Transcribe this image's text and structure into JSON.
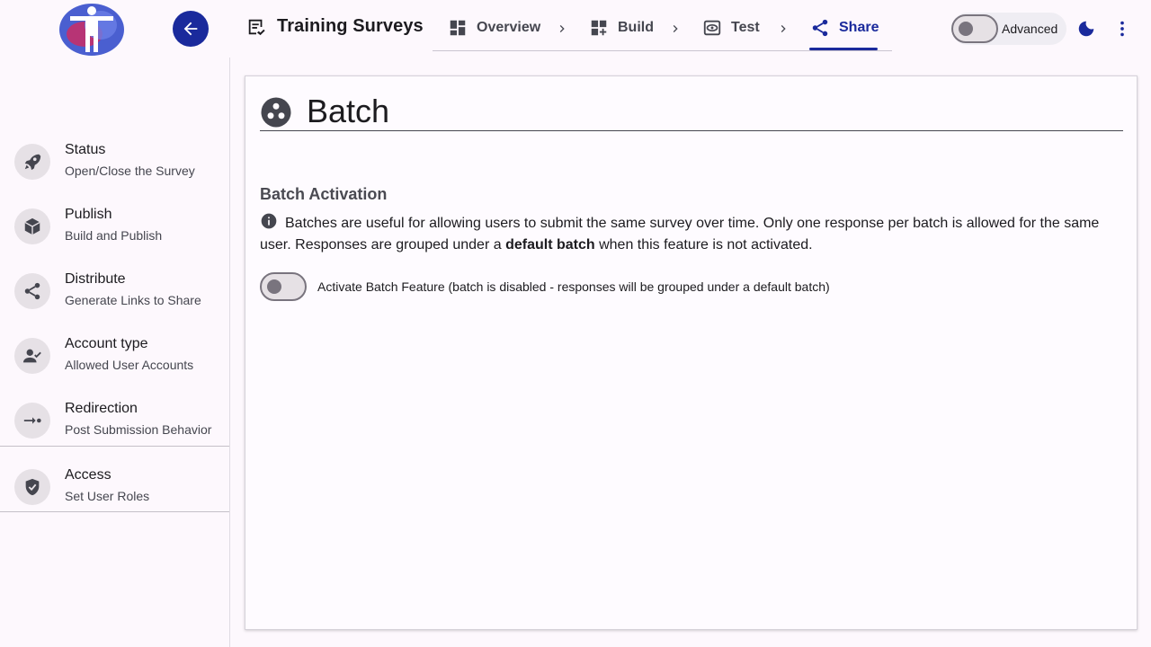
{
  "header": {
    "survey_title": "Training Surveys",
    "advanced_label": "Advanced",
    "advanced_enabled": false
  },
  "nav": {
    "tabs": [
      {
        "label": "Overview",
        "icon": "dashboard-icon",
        "active": false
      },
      {
        "label": "Build",
        "icon": "dashboard-add-icon",
        "active": false
      },
      {
        "label": "Test",
        "icon": "preview-eye-icon",
        "active": false
      },
      {
        "label": "Share",
        "icon": "share-icon",
        "active": true
      }
    ]
  },
  "sidebar": {
    "items": [
      {
        "title": "Status",
        "subtitle": "Open/Close the Survey",
        "icon": "rocket-icon"
      },
      {
        "title": "Publish",
        "subtitle": "Build and Publish",
        "icon": "cube-icon"
      },
      {
        "title": "Distribute",
        "subtitle": "Generate Links to Share",
        "icon": "share-icon"
      },
      {
        "title": "Account type",
        "subtitle": "Allowed User Accounts",
        "icon": "person-check-icon"
      },
      {
        "title": "Redirection",
        "subtitle": "Post Submission Behavior",
        "icon": "redirect-icon"
      },
      {
        "title": "Access",
        "subtitle": "Set User Roles",
        "icon": "shield-check-icon"
      }
    ]
  },
  "main": {
    "title": "Batch",
    "title_icon": "batch-dots-icon",
    "section_title": "Batch Activation",
    "info_before": "Batches are useful for allowing users to submit the same survey over time. Only one response per batch is allowed for the same user. Responses are grouped under a ",
    "info_bold": "default batch",
    "info_after": " when this feature is not activated.",
    "toggle_label": "Activate Batch Feature (batch is disabled - responses will be grouped under a default batch)",
    "toggle_enabled": false
  },
  "colors": {
    "primary": "#1a2a9c",
    "background": "#fdf8fd"
  }
}
